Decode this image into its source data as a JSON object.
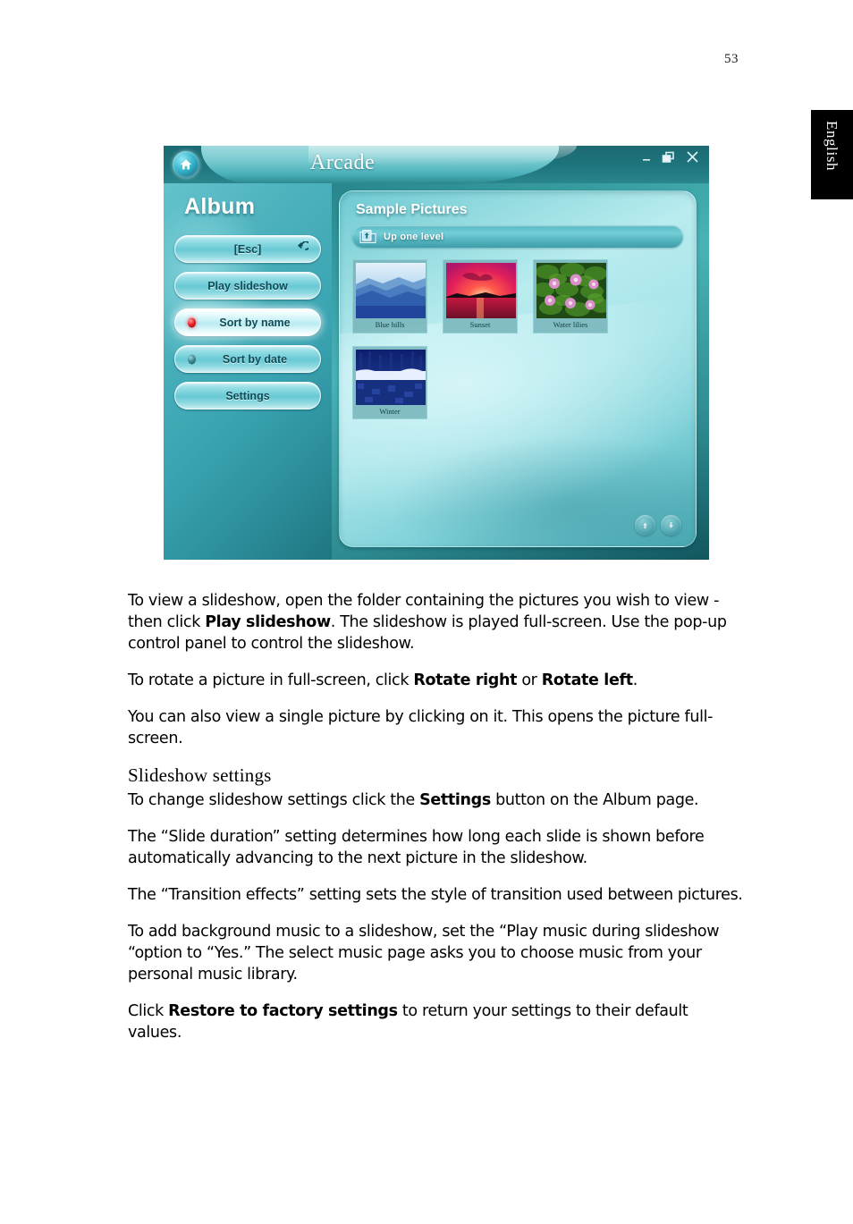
{
  "page": {
    "number": "53",
    "language_tab": "English"
  },
  "screenshot": {
    "titlebar": {
      "app_title": "Arcade",
      "home_icon": "home-icon",
      "minimize_label": "_",
      "restore_label": "restore",
      "close_label": "×"
    },
    "sidebar": {
      "heading": "Album",
      "items": [
        {
          "label": "[Esc]",
          "led": "none",
          "arrow": "↺",
          "active": false
        },
        {
          "label": "Play slideshow",
          "led": "none",
          "active": false
        },
        {
          "label": "Sort by name",
          "led": "on",
          "active": true
        },
        {
          "label": "Sort by date",
          "led": "off",
          "active": false
        },
        {
          "label": "Settings",
          "led": "none",
          "active": false
        }
      ]
    },
    "content": {
      "title": "Sample Pictures",
      "up_one_level": "Up one level",
      "thumbnails": [
        {
          "caption": "Blue hills"
        },
        {
          "caption": "Sunset"
        },
        {
          "caption": "Water lilies"
        },
        {
          "caption": "Winter"
        }
      ],
      "scroll_up": "▲",
      "scroll_down": "▼"
    }
  },
  "body": {
    "p1_a": "To view a slideshow, open the folder containing the pictures you wish to view - then click  ",
    "p1_b": "Play slideshow",
    "p1_c": ". The slideshow is played full-screen. Use the pop-up control panel to control the slideshow.",
    "p2_a": "To rotate a picture in full-screen, click  ",
    "p2_b": "Rotate right",
    "p2_c": " or ",
    "p2_d": "Rotate left",
    "p2_e": ".",
    "p3": "You can also view a single picture by clicking on it. This opens the picture full-screen.",
    "heading": "Slideshow settings",
    "p4_a": "To change slideshow settings click the ",
    "p4_b": "Settings",
    "p4_c": " button on the Album page.",
    "p5": "The “Slide duration” setting determines how long each slide is shown before automatically advancing to the next picture in the slideshow.",
    "p6": "The “Transition effects” setting sets the style of transition used between pictures.",
    "p7": "To add background music to a slideshow, set the “Play music during slideshow “option to “Yes.” The select music page asks you to choose music from your personal music library.",
    "p8_a": "Click ",
    "p8_b": "Restore to factory settings",
    "p8_c": " to return your settings to their default values."
  },
  "colors": {
    "teal_dark": "#1b6d74",
    "teal_mid": "#49b3b6",
    "panel_light": "#b9ecef",
    "led_on": "#e8232a",
    "tab_black": "#000000"
  }
}
